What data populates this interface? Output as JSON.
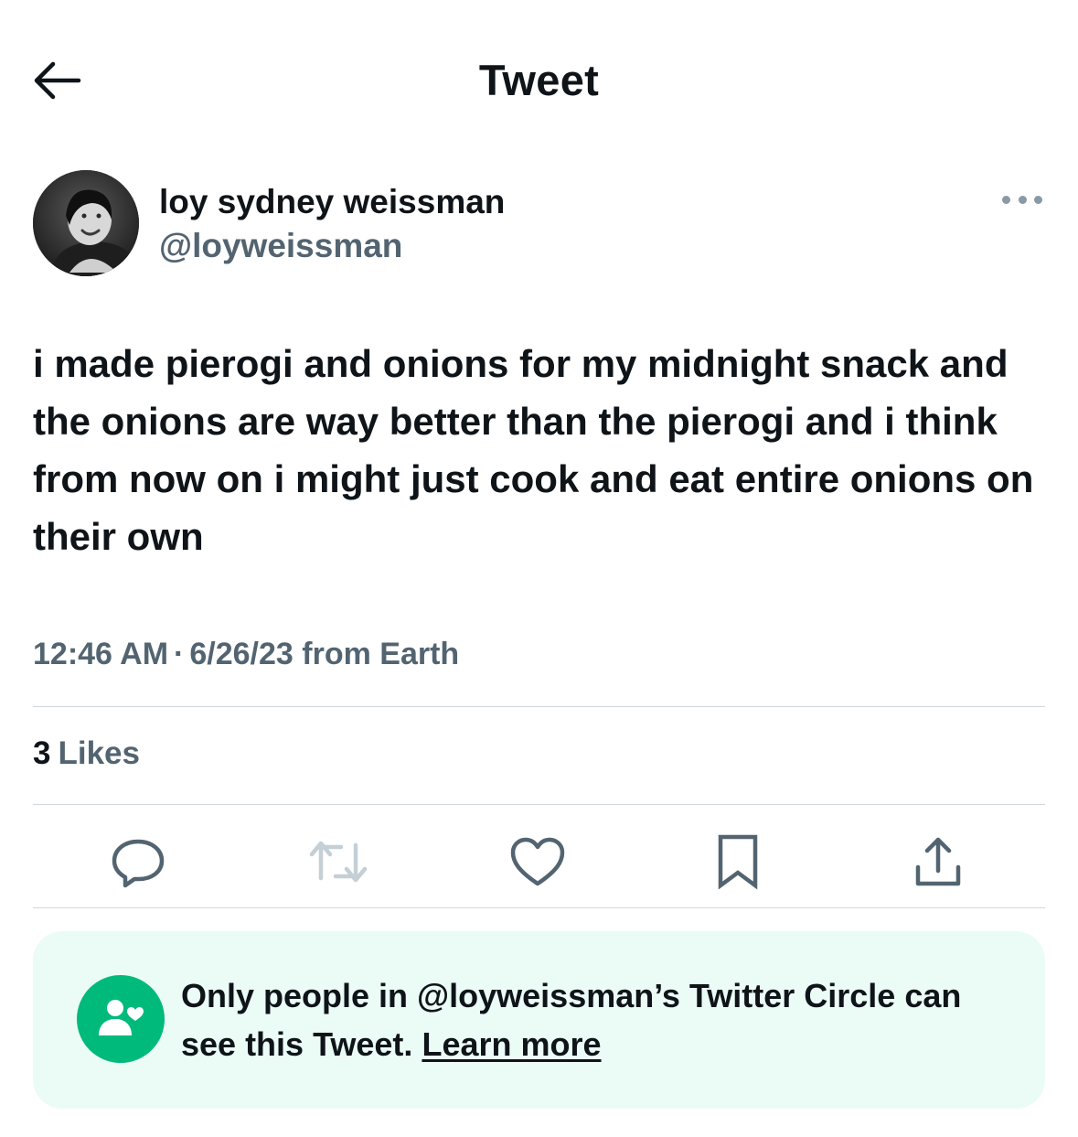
{
  "header": {
    "title": "Tweet",
    "back_icon": "arrow-left-icon"
  },
  "author": {
    "display_name": "loy sydney weissman",
    "handle": "@loyweissman",
    "more_icon": "more-horizontal-icon"
  },
  "tweet": {
    "text": "i made pierogi and onions for my midnight snack and the onions are way better than the pierogi and i think from now on i might just cook and eat entire onions on their own",
    "time": "12:46 AM",
    "separator": "·",
    "date": "6/26/23",
    "source": "from Earth"
  },
  "stats": {
    "likes_count": "3",
    "likes_label": "Likes"
  },
  "actions": [
    {
      "name": "reply",
      "icon": "reply-icon"
    },
    {
      "name": "retweet",
      "icon": "retweet-icon",
      "disabled": true
    },
    {
      "name": "like",
      "icon": "heart-icon"
    },
    {
      "name": "bookmark",
      "icon": "bookmark-icon"
    },
    {
      "name": "share",
      "icon": "share-icon"
    }
  ],
  "circle_notice": {
    "text": "Only people in @loyweissman’s Twitter Circle can see this Tweet.",
    "link": "Learn more",
    "icon": "twitter-circle-icon"
  },
  "colors": {
    "text_primary": "#0f1419",
    "text_secondary": "#536471",
    "divider": "#cfd9de",
    "circle_bg": "#ebfbf6",
    "circle_accent": "#00ba7c",
    "icon": "#536471",
    "icon_disabled": "#c4cfd6"
  }
}
